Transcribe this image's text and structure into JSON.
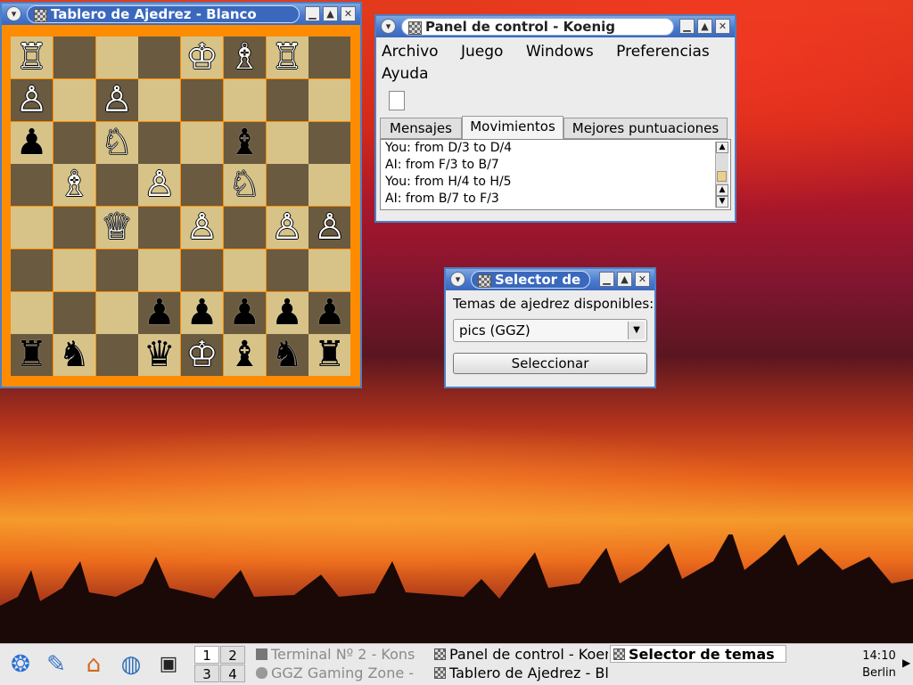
{
  "colors": {
    "accent": "#4a7bd0",
    "board_frame": "#ff8c00",
    "light_square": "#d7c387",
    "dark_square": "#6a5a40"
  },
  "chess_window": {
    "title": "Tablero de Ajedrez - Blanco",
    "pieces": [
      {
        "sq": "a8",
        "glyph": "♖",
        "color": "white",
        "name": "white-rook"
      },
      {
        "sq": "e8",
        "glyph": "♔",
        "color": "white",
        "name": "white-king"
      },
      {
        "sq": "f8",
        "glyph": "♗",
        "color": "white",
        "name": "white-bishop"
      },
      {
        "sq": "g8",
        "glyph": "♖",
        "color": "white",
        "name": "white-rook"
      },
      {
        "sq": "a7",
        "glyph": "♙",
        "color": "white",
        "name": "white-pawn"
      },
      {
        "sq": "c7",
        "glyph": "♙",
        "color": "white",
        "name": "white-pawn"
      },
      {
        "sq": "a6",
        "glyph": "♟",
        "color": "black",
        "name": "black-pawn"
      },
      {
        "sq": "c6",
        "glyph": "♘",
        "color": "white",
        "name": "white-knight"
      },
      {
        "sq": "f6",
        "glyph": "♝",
        "color": "black",
        "name": "black-bishop"
      },
      {
        "sq": "b5",
        "glyph": "♗",
        "color": "white",
        "name": "white-bishop"
      },
      {
        "sq": "d5",
        "glyph": "♙",
        "color": "white",
        "name": "white-pawn"
      },
      {
        "sq": "f5",
        "glyph": "♘",
        "color": "white",
        "name": "white-knight"
      },
      {
        "sq": "c4",
        "glyph": "♕",
        "color": "white",
        "name": "white-queen"
      },
      {
        "sq": "e4",
        "glyph": "♙",
        "color": "white",
        "name": "white-pawn"
      },
      {
        "sq": "g4",
        "glyph": "♙",
        "color": "white",
        "name": "white-pawn"
      },
      {
        "sq": "h4",
        "glyph": "♙",
        "color": "white",
        "name": "white-pawn"
      },
      {
        "sq": "d2",
        "glyph": "♟",
        "color": "black",
        "name": "black-pawn"
      },
      {
        "sq": "e2",
        "glyph": "♟",
        "color": "black",
        "name": "black-pawn"
      },
      {
        "sq": "f2",
        "glyph": "♟",
        "color": "black",
        "name": "black-pawn"
      },
      {
        "sq": "g2",
        "glyph": "♟",
        "color": "black",
        "name": "black-pawn"
      },
      {
        "sq": "h2",
        "glyph": "♟",
        "color": "black",
        "name": "black-pawn"
      },
      {
        "sq": "a1",
        "glyph": "♜",
        "color": "black",
        "name": "black-rook"
      },
      {
        "sq": "b1",
        "glyph": "♞",
        "color": "black",
        "name": "black-knight"
      },
      {
        "sq": "d1",
        "glyph": "♛",
        "color": "black",
        "name": "black-queen"
      },
      {
        "sq": "e1",
        "glyph": "♔",
        "color": "white",
        "name": "white-king"
      },
      {
        "sq": "f1",
        "glyph": "♝",
        "color": "black",
        "name": "black-bishop"
      },
      {
        "sq": "g1",
        "glyph": "♞",
        "color": "black",
        "name": "black-knight"
      },
      {
        "sq": "h1",
        "glyph": "♜",
        "color": "black",
        "name": "black-rook"
      }
    ]
  },
  "control_panel": {
    "title": "Panel de control - Koenig",
    "menu": [
      "Archivo",
      "Juego",
      "Windows",
      "Preferencias",
      "Ayuda"
    ],
    "tabs": [
      "Mensajes",
      "Movimientos",
      "Mejores puntuaciones"
    ],
    "active_tab": "Movimientos",
    "moves": [
      "You: from D/3 to D/4",
      "AI: from F/3 to B/7",
      "You: from H/4 to H/5",
      "AI: from B/7 to F/3"
    ]
  },
  "theme_selector": {
    "title": "Selector de",
    "label": "Temas de ajedrez disponibles:",
    "selected": "pics (GGZ)",
    "button": "Seleccionar"
  },
  "taskbar": {
    "launchers": [
      "kde-menu-icon",
      "kwrite-icon",
      "home-icon",
      "browser-globe-icon",
      "terminal-icon"
    ],
    "pager": [
      "1",
      "2",
      "3",
      "4"
    ],
    "tasks": [
      {
        "label": "Terminal Nº 2 - Kons",
        "style": "dim"
      },
      {
        "label": "Panel de control - Koenig",
        "style": "normal"
      },
      {
        "label": "Selector de temas",
        "style": "bold"
      },
      {
        "label": "GGZ Gaming Zone -",
        "style": "dim"
      },
      {
        "label": "Tablero de Ajedrez - Blanco",
        "style": "normal"
      }
    ],
    "clock_time": "14:10",
    "clock_city": "Berlin"
  }
}
